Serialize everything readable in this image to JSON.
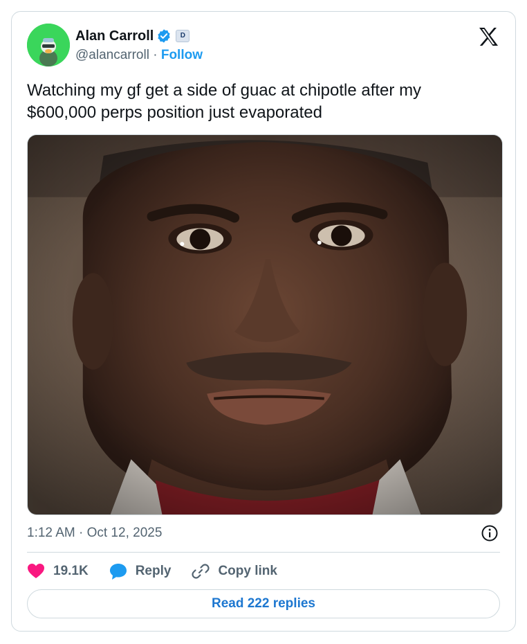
{
  "author": {
    "name": "Alan Carroll",
    "handle": "@alancarroll",
    "separator": "·",
    "follow_label": "Follow",
    "avatar_color": "#3ad65b",
    "verified": true
  },
  "tweet": {
    "text": "Watching my gf get a side of guac at chipotle after my $600,000 perps position just evaporated",
    "timestamp": "1:12 AM · Oct 12, 2025"
  },
  "actions": {
    "likes": "19.1K",
    "reply_label": "Reply",
    "copy_link_label": "Copy link"
  },
  "read_replies_label": "Read 222 replies",
  "icons": [
    "x-logo-icon",
    "verified-icon",
    "info-icon",
    "heart-icon",
    "reply-bubble-icon",
    "link-icon"
  ],
  "colors": {
    "accent": "#1d9bf0",
    "like": "#f91880",
    "muted": "#536471",
    "border": "#cfd9de"
  }
}
